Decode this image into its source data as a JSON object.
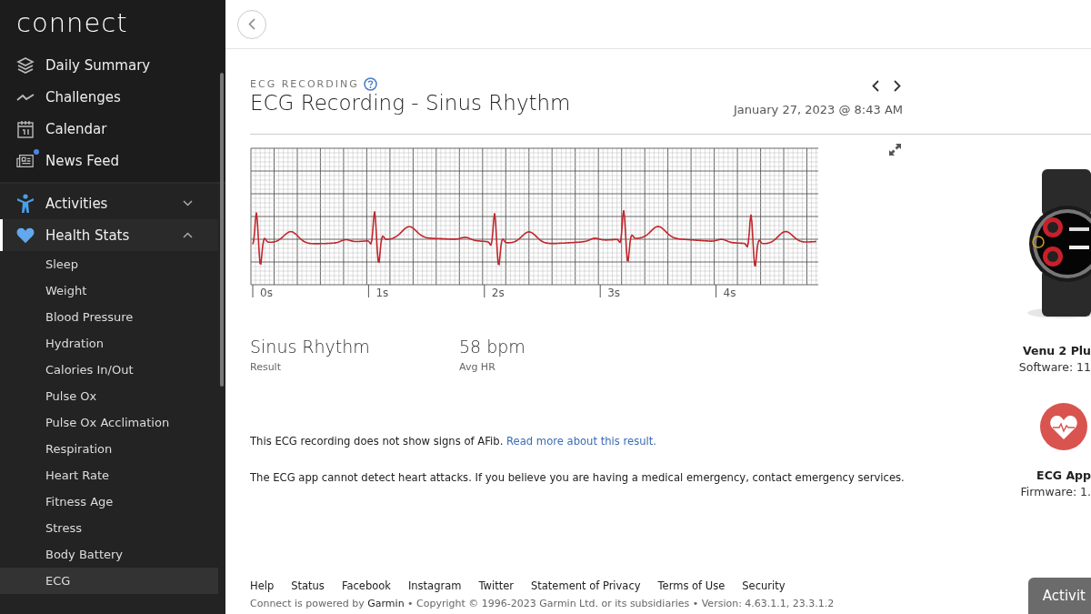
{
  "sidebar": {
    "logo": "connect",
    "items": [
      {
        "label": "Daily Summary",
        "kind": "link",
        "selected": false,
        "badge": false
      },
      {
        "label": "Challenges",
        "kind": "link",
        "selected": false,
        "badge": false
      },
      {
        "label": "Calendar",
        "kind": "link",
        "selected": false,
        "badge": false
      },
      {
        "label": "News Feed",
        "kind": "link",
        "selected": false,
        "badge": true
      },
      {
        "label": "Activities",
        "kind": "group",
        "selected": false,
        "badge": false,
        "expanded": false
      },
      {
        "label": "Health Stats",
        "kind": "group",
        "selected": true,
        "badge": false,
        "expanded": true,
        "children": [
          {
            "label": "Sleep",
            "selected": false
          },
          {
            "label": "Weight",
            "selected": false
          },
          {
            "label": "Blood Pressure",
            "selected": false
          },
          {
            "label": "Hydration",
            "selected": false
          },
          {
            "label": "Calories In/Out",
            "selected": false
          },
          {
            "label": "Pulse Ox",
            "selected": false
          },
          {
            "label": "Pulse Ox Acclimation",
            "selected": false
          },
          {
            "label": "Respiration",
            "selected": false
          },
          {
            "label": "Heart Rate",
            "selected": false
          },
          {
            "label": "Fitness Age",
            "selected": false
          },
          {
            "label": "Stress",
            "selected": false
          },
          {
            "label": "Body Battery",
            "selected": false
          },
          {
            "label": "ECG",
            "selected": true
          }
        ]
      }
    ]
  },
  "recording": {
    "eyebrow": "ECG RECORDING",
    "title": "ECG Recording - Sinus Rhythm",
    "date": "January 27, 2023 @ 8:43 AM"
  },
  "ecg": {
    "axis_labels": [
      "0s",
      "1s",
      "2s",
      "3s",
      "4s"
    ]
  },
  "stats": [
    {
      "value": "Sinus Rhythm",
      "label": "Result"
    },
    {
      "value": "58 bpm",
      "label": "Avg HR"
    }
  ],
  "messages": [
    {
      "text": "This ECG recording does not show signs of AFib.",
      "link": "Read more about this result."
    },
    {
      "text": "The ECG app cannot detect heart attacks. If you believe you are having a medical emergency, contact emergency services."
    }
  ],
  "devices": [
    {
      "kind": "picture",
      "name": "Venu 2 Plu",
      "detail": "Software: 11"
    },
    {
      "kind": "app",
      "name": "ECG App",
      "detail": "Firmware: 1."
    }
  ],
  "footer": {
    "links": [
      "Help",
      "Status",
      "Facebook",
      "Instagram",
      "Twitter",
      "Statement of Privacy",
      "Terms of Use",
      "Security"
    ],
    "copyright": "Connect is powered by **Garmin** • Copyright © 1996-2023 Garmin Ltd. or its subsidiaries • Version: 4.63.1.1, 23.3.1.2"
  },
  "activity_button": "Activit"
}
